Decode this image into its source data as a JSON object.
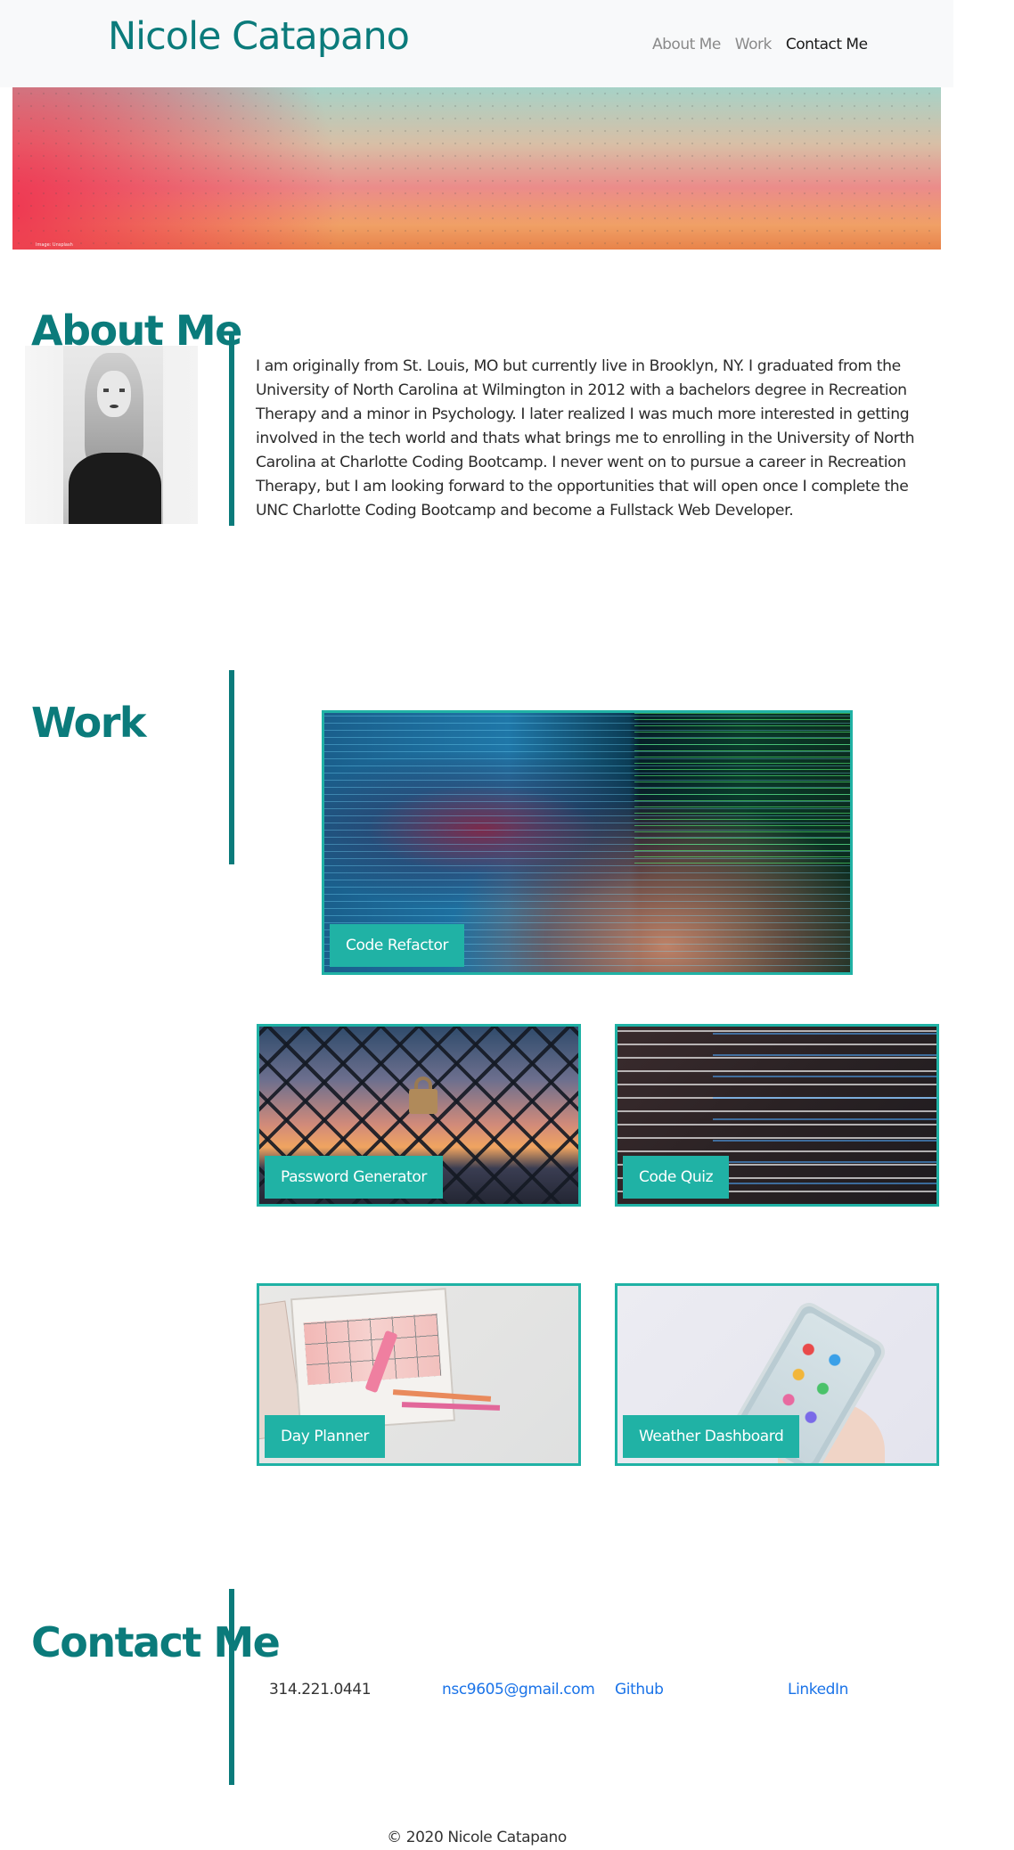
{
  "navbar": {
    "brand": "Nicole Catapano",
    "links": [
      {
        "label": "About Me"
      },
      {
        "label": "Work"
      },
      {
        "label": "Contact Me"
      }
    ]
  },
  "hero": {
    "caption": "Image: Unsplash"
  },
  "about": {
    "title": "About Me",
    "text": "I am originally from St. Louis, MO but currently live in Brooklyn, NY. I graduated from the University of North Carolina at Wilmington in 2012 with a bachelors degree in Recreation Therapy and a minor in Psychology. I later realized I was much more interested in getting involved in the tech world and thats what brings me to enrolling in the University of North Carolina at Charlotte Coding Bootcamp. I never went on to pursue a career in Recreation Therapy, but I am looking forward to the opportunities that will open once I complete the UNC Charlotte Coding Bootcamp and become a Fullstack Web Developer."
  },
  "work": {
    "title": "Work",
    "projects": [
      {
        "label": "Code Refactor"
      },
      {
        "label": "Password Generator"
      },
      {
        "label": "Code Quiz"
      },
      {
        "label": "Day Planner"
      },
      {
        "label": "Weather Dashboard"
      }
    ]
  },
  "contact": {
    "title": "Contact Me",
    "phone": "314.221.0441",
    "email": "nsc9605@gmail.com",
    "github": "Github",
    "linkedin": "LinkedIn"
  },
  "footer": {
    "text": "© 2020 Nicole Catapano"
  },
  "colors": {
    "accent": "#0b7b7b",
    "card_border": "#20b2a5",
    "link": "#1a73e8"
  }
}
